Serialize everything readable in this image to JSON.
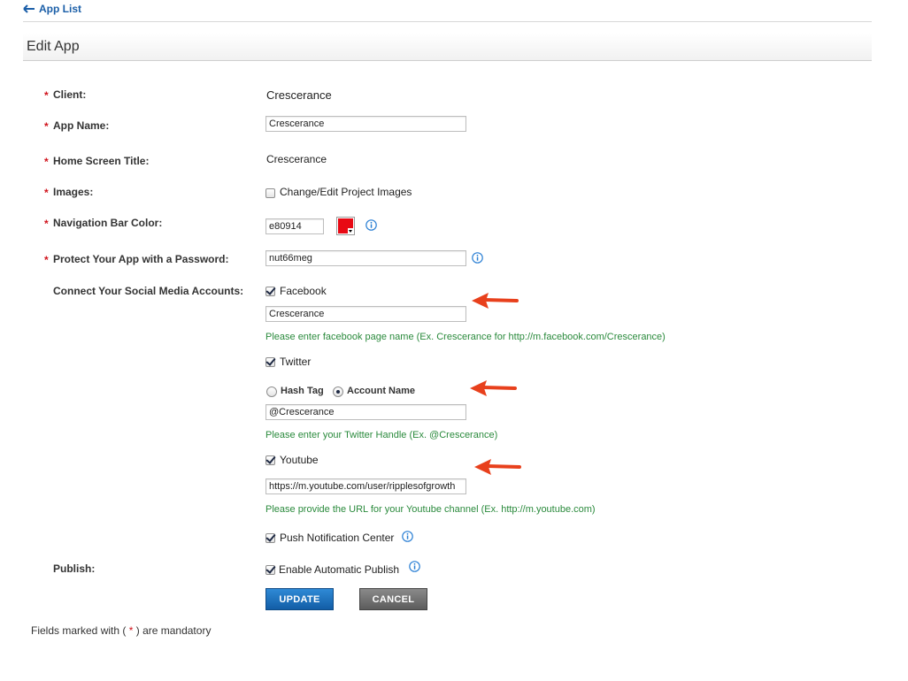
{
  "nav": {
    "back_label": "App List"
  },
  "page": {
    "title": "Edit App"
  },
  "required_marker": "*",
  "form": {
    "client": {
      "label": "Client:",
      "value": "Crescerance"
    },
    "app_name": {
      "label": "App Name:",
      "value": "Crescerance"
    },
    "home_title": {
      "label": "Home Screen Title:",
      "value": "Crescerance"
    },
    "images": {
      "label": "Images:",
      "checkbox_label": "Change/Edit Project Images",
      "checked": false
    },
    "nav_color": {
      "label": "Navigation Bar Color:",
      "value": "e80914",
      "color": "#e80914"
    },
    "password": {
      "label": "Protect Your App with a Password:",
      "value": "nut66meg"
    },
    "social": {
      "label": "Connect Your Social Media Accounts:",
      "facebook": {
        "label": "Facebook",
        "checked": true,
        "value": "Crescerance",
        "hint": "Please enter facebook page name (Ex. Crescerance for http://m.facebook.com/Crescerance)"
      },
      "twitter": {
        "label": "Twitter",
        "checked": true,
        "radio_hashtag": "Hash Tag",
        "radio_account": "Account Name",
        "selected": "Account Name",
        "value": "@Crescerance",
        "hint": "Please enter your Twitter Handle (Ex. @Crescerance)"
      },
      "youtube": {
        "label": "Youtube",
        "checked": true,
        "value": "https://m.youtube.com/user/ripplesofgrowth",
        "hint": "Please provide the URL for your Youtube channel (Ex. http://m.youtube.com)"
      },
      "push": {
        "label": "Push Notification Center",
        "checked": true
      }
    },
    "publish": {
      "label": "Publish:",
      "checkbox_label": "Enable Automatic Publish",
      "checked": true
    }
  },
  "buttons": {
    "update": "UPDATE",
    "cancel": "CANCEL"
  },
  "footer": {
    "prefix": "Fields marked with (",
    "marker": "*",
    "suffix": ") are mandatory"
  },
  "colors": {
    "link": "#1b5fa8",
    "required": "#d0121b",
    "hint": "#2a8a3c",
    "annotation_arrow": "#e8401c"
  }
}
